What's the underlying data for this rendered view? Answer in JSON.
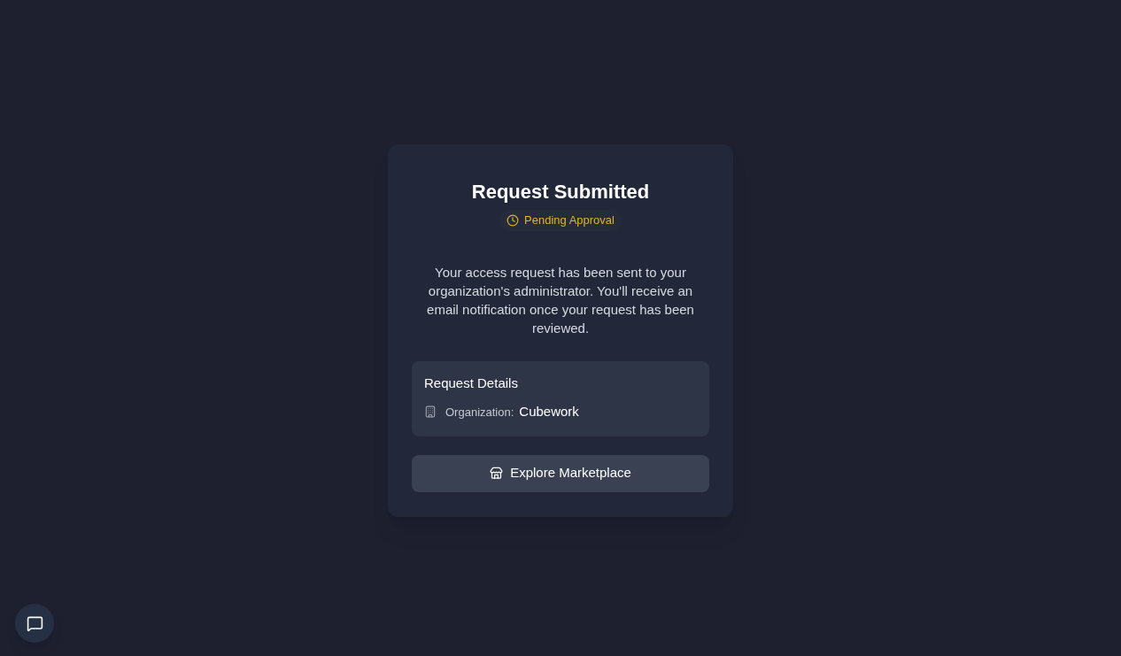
{
  "card": {
    "title": "Request Submitted",
    "status": {
      "label": "Pending Approval",
      "kind": "pending"
    },
    "message": "Your access request has been sent to your organization's administrator. You'll receive an email notification once your request has been reviewed.",
    "details": {
      "heading": "Request Details",
      "fields": [
        {
          "label": "Organization:",
          "value": "Cubework"
        }
      ]
    },
    "button": {
      "label": "Explore Marketplace"
    }
  }
}
